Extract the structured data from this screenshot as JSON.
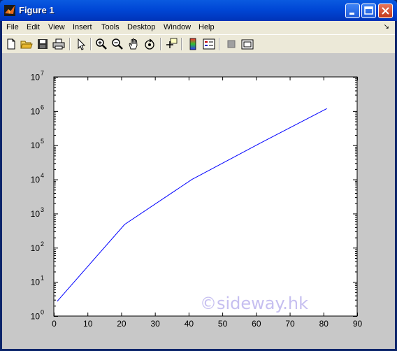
{
  "window": {
    "title": "Figure 1"
  },
  "menu": {
    "items": [
      "File",
      "Edit",
      "View",
      "Insert",
      "Tools",
      "Desktop",
      "Window",
      "Help"
    ],
    "arrow": "↘"
  },
  "toolbar": {
    "icons": [
      "new-figure-icon",
      "open-file-icon",
      "save-icon",
      "print-icon",
      "edit-plot-icon",
      "zoom-in-icon",
      "zoom-out-icon",
      "pan-icon",
      "rotate-3d-icon",
      "data-cursor-icon",
      "colorbar-icon",
      "legend-icon",
      "hide-plot-tools-icon",
      "show-plot-tools-icon"
    ]
  },
  "watermark": "©sideway.hk",
  "colors": {
    "line": "#0000ff",
    "figure_bg": "#c8c8c8",
    "axes_bg": "#ffffff"
  },
  "chart_data": {
    "type": "line",
    "title": "",
    "xlabel": "",
    "ylabel": "",
    "xlim": [
      0,
      90
    ],
    "ylim": [
      1,
      10000000
    ],
    "yscale": "log",
    "grid": false,
    "x_ticks": [
      "0",
      "10",
      "20",
      "30",
      "40",
      "50",
      "60",
      "70",
      "80",
      "90"
    ],
    "y_ticks": [
      {
        "base": "10",
        "exp": "0"
      },
      {
        "base": "10",
        "exp": "1"
      },
      {
        "base": "10",
        "exp": "2"
      },
      {
        "base": "10",
        "exp": "3"
      },
      {
        "base": "10",
        "exp": "4"
      },
      {
        "base": "10",
        "exp": "5"
      },
      {
        "base": "10",
        "exp": "6"
      },
      {
        "base": "10",
        "exp": "7"
      }
    ],
    "series": [
      {
        "x": [
          1,
          21,
          41,
          61,
          81
        ],
        "y": [
          2.7,
          481,
          10000,
          112000,
          1180000
        ]
      }
    ]
  }
}
